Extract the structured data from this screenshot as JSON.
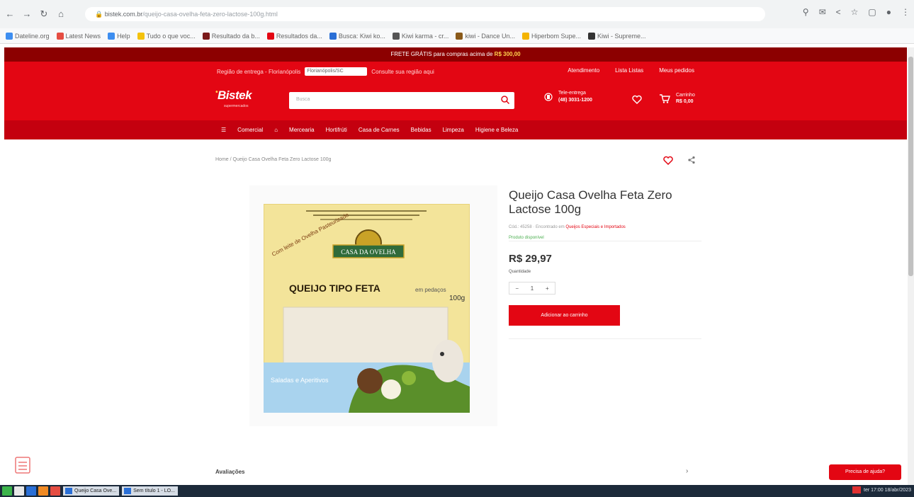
{
  "browser": {
    "url_host": "bistek.com.br",
    "url_path": "/queijo-casa-ovelha-feta-zero-lactose-100g.html",
    "bookmarks": [
      {
        "label": "Dateline.org",
        "color": "#3d8ef0"
      },
      {
        "label": "Latest News",
        "color": "#e54d42"
      },
      {
        "label": "Help",
        "color": "#3d8ef0"
      },
      {
        "label": "Tudo o que voc...",
        "color": "#f4c20d"
      },
      {
        "label": "Resultado da b...",
        "color": "#7b1a1a"
      },
      {
        "label": "Resultados da...",
        "color": "#e30613"
      },
      {
        "label": "Busca: Kiwi ko...",
        "color": "#2a6fd6"
      },
      {
        "label": "Kiwi karma - cr...",
        "color": "#555555"
      },
      {
        "label": "kiwi - Dance Un...",
        "color": "#8a5a1a"
      },
      {
        "label": "Hiperbom Supe...",
        "color": "#f4b400"
      },
      {
        "label": "Kiwi - Supreme...",
        "color": "#333333"
      }
    ]
  },
  "site": {
    "promo_text": "FRETE GRÁTIS para compras acima de",
    "promo_value": "R$ 300,00",
    "region_label": "Região de entrega - Florianópolis",
    "region_select": "Florianópolis/SC",
    "region_hint": "Consulte sua região aqui",
    "top_links": [
      "Atendimento",
      "Lista Listas",
      "Meus pedidos"
    ],
    "logo": "Bistek",
    "logo_tagline": "supermercados",
    "search_placeholder": "Busca",
    "contact_line1": "Tele-entrega",
    "contact_line2": "(48) 3031-1200",
    "cart_label": "Carrinho",
    "cart_value": "R$ 0,00",
    "categories": [
      "☰",
      "Comercial",
      "⌂",
      "Mercearia",
      "Hortifrúti",
      "Casa de Carnes",
      "Bebidas",
      "Limpeza",
      "Higiene e Beleza"
    ]
  },
  "product": {
    "breadcrumb": "Home  /  Queijo Casa Ovelha Feta Zero Lactose 100g",
    "title": "Queijo Casa Ovelha Feta Zero Lactose 100g",
    "sku": "Cód.: 45258",
    "category_prefix": "Encontrado em",
    "category": "Queijos Especiais e Importados",
    "stock": "Produto disponível",
    "price": "R$ 29,97",
    "qty_label": "Quantidade",
    "qty_value": "1",
    "add_button": "Adicionar ao carrinho",
    "reviews_label": "Avaliações",
    "help_button": "Precisa de ajuda?",
    "package_brand": "CASA DA OVELHA",
    "package_title": "QUEIJO TIPO FETA",
    "package_weight": "100g",
    "package_badge": "Com leite de Ovelha Pasteurizado",
    "package_suggest": "Saladas e Aperitivos",
    "package_side": "em pedaços"
  },
  "taskbar": {
    "tasks": [
      "Queijo Casa Ove...",
      "Sem título 1 - LO..."
    ],
    "clock": "ter 17:00 18/abr/2023"
  }
}
